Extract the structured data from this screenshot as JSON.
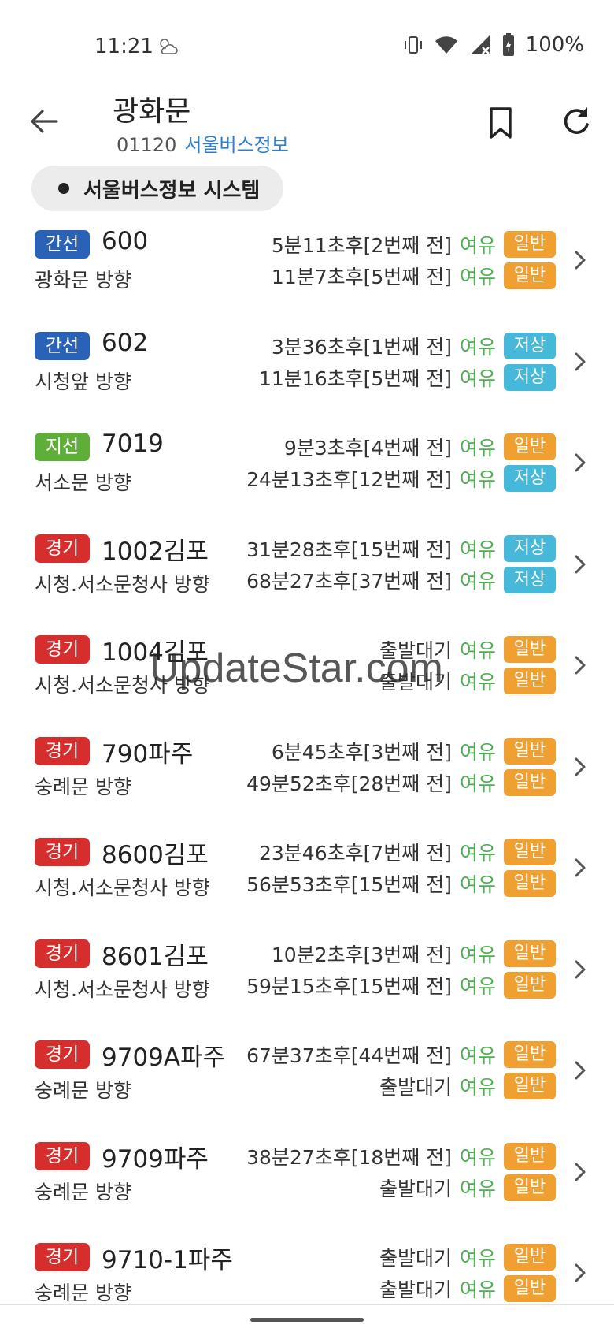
{
  "status_bar": {
    "time": "11:21",
    "weather_icon": "partly-cloudy-icon",
    "battery_text": "100%"
  },
  "header": {
    "title": "광화문",
    "stop_id": "01120",
    "source": "서울버스정보"
  },
  "system_chip": {
    "label": "서울버스정보 시스템"
  },
  "colors": {
    "trunk": "#2a62b8",
    "branch": "#5fae3a",
    "gyeonggi": "#d62d2d",
    "crowd_green": "#4caf50",
    "badge_normal": "#f0a030",
    "badge_low": "#46b8da",
    "link_blue": "#2e7fd0"
  },
  "routes": [
    {
      "type": "간선",
      "type_class": "type-trunk",
      "number": "600",
      "direction": "광화문 방향",
      "arrivals": [
        {
          "time": "5분11초후[2번째 전]",
          "crowd": "여유",
          "bus": "일반",
          "bus_class": "badge-normal"
        },
        {
          "time": "11분7초후[5번째 전]",
          "crowd": "여유",
          "bus": "일반",
          "bus_class": "badge-normal"
        }
      ]
    },
    {
      "type": "간선",
      "type_class": "type-trunk",
      "number": "602",
      "direction": "시청앞 방향",
      "arrivals": [
        {
          "time": "3분36초후[1번째 전]",
          "crowd": "여유",
          "bus": "저상",
          "bus_class": "badge-low"
        },
        {
          "time": "11분16초후[5번째 전]",
          "crowd": "여유",
          "bus": "저상",
          "bus_class": "badge-low"
        }
      ]
    },
    {
      "type": "지선",
      "type_class": "type-branch",
      "number": "7019",
      "direction": "서소문 방향",
      "arrivals": [
        {
          "time": "9분3초후[4번째 전]",
          "crowd": "여유",
          "bus": "일반",
          "bus_class": "badge-normal"
        },
        {
          "time": "24분13초후[12번째 전]",
          "crowd": "여유",
          "bus": "저상",
          "bus_class": "badge-low"
        }
      ]
    },
    {
      "type": "경기",
      "type_class": "type-gyeonggi",
      "number": "1002김포",
      "direction": "시청.서소문청사 방향",
      "arrivals": [
        {
          "time": "31분28초후[15번째 전]",
          "crowd": "여유",
          "bus": "저상",
          "bus_class": "badge-low"
        },
        {
          "time": "68분27초후[37번째 전]",
          "crowd": "여유",
          "bus": "저상",
          "bus_class": "badge-low"
        }
      ]
    },
    {
      "type": "경기",
      "type_class": "type-gyeonggi",
      "number": "1004김포",
      "direction": "시청.서소문청사 방향",
      "arrivals": [
        {
          "time": "출발대기",
          "crowd": "여유",
          "bus": "일반",
          "bus_class": "badge-normal"
        },
        {
          "time": "출발대기",
          "crowd": "여유",
          "bus": "일반",
          "bus_class": "badge-normal"
        }
      ]
    },
    {
      "type": "경기",
      "type_class": "type-gyeonggi",
      "number": "790파주",
      "direction": "숭례문 방향",
      "arrivals": [
        {
          "time": "6분45초후[3번째 전]",
          "crowd": "여유",
          "bus": "일반",
          "bus_class": "badge-normal"
        },
        {
          "time": "49분52초후[28번째 전]",
          "crowd": "여유",
          "bus": "일반",
          "bus_class": "badge-normal"
        }
      ]
    },
    {
      "type": "경기",
      "type_class": "type-gyeonggi",
      "number": "8600김포",
      "direction": "시청.서소문청사 방향",
      "arrivals": [
        {
          "time": "23분46초후[7번째 전]",
          "crowd": "여유",
          "bus": "일반",
          "bus_class": "badge-normal"
        },
        {
          "time": "56분53초후[15번째 전]",
          "crowd": "여유",
          "bus": "일반",
          "bus_class": "badge-normal"
        }
      ]
    },
    {
      "type": "경기",
      "type_class": "type-gyeonggi",
      "number": "8601김포",
      "direction": "시청.서소문청사 방향",
      "arrivals": [
        {
          "time": "10분2초후[3번째 전]",
          "crowd": "여유",
          "bus": "일반",
          "bus_class": "badge-normal"
        },
        {
          "time": "59분15초후[15번째 전]",
          "crowd": "여유",
          "bus": "일반",
          "bus_class": "badge-normal"
        }
      ]
    },
    {
      "type": "경기",
      "type_class": "type-gyeonggi",
      "number": "9709A파주",
      "direction": "숭례문 방향",
      "arrivals": [
        {
          "time": "67분37초후[44번째 전]",
          "crowd": "여유",
          "bus": "일반",
          "bus_class": "badge-normal"
        },
        {
          "time": "출발대기",
          "crowd": "여유",
          "bus": "일반",
          "bus_class": "badge-normal"
        }
      ]
    },
    {
      "type": "경기",
      "type_class": "type-gyeonggi",
      "number": "9709파주",
      "direction": "숭례문 방향",
      "arrivals": [
        {
          "time": "38분27초후[18번째 전]",
          "crowd": "여유",
          "bus": "일반",
          "bus_class": "badge-normal"
        },
        {
          "time": "출발대기",
          "crowd": "여유",
          "bus": "일반",
          "bus_class": "badge-normal"
        }
      ]
    },
    {
      "type": "경기",
      "type_class": "type-gyeonggi",
      "number": "9710-1파주",
      "direction": "숭례문 방향",
      "arrivals": [
        {
          "time": "출발대기",
          "crowd": "여유",
          "bus": "일반",
          "bus_class": "badge-normal"
        },
        {
          "time": "출발대기",
          "crowd": "여유",
          "bus": "일반",
          "bus_class": "badge-normal"
        }
      ]
    }
  ],
  "watermark": "UpdateStar.com"
}
